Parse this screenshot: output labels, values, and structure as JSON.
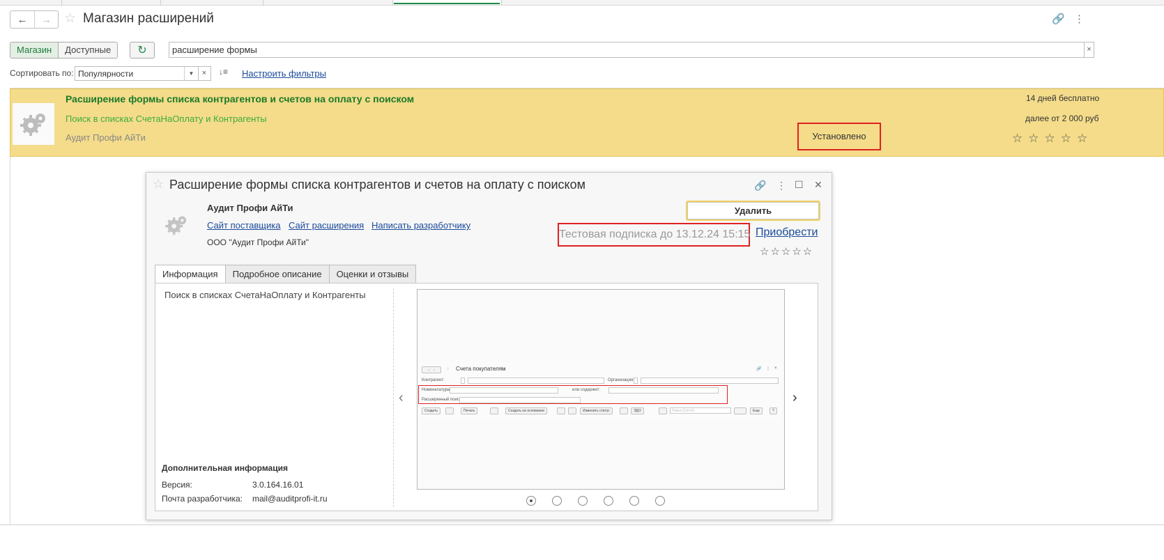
{
  "window": {
    "title": "Магазин расширений",
    "nav_back_icon": "←",
    "nav_forward_icon": "→",
    "favorite_icon": "☆",
    "link_icon": "🔗",
    "more_icon": "⋮"
  },
  "toolbar": {
    "tab_store": "Магазин",
    "tab_available": "Доступные",
    "refresh_icon": "↻",
    "search_value": "расширение формы",
    "search_clear": "×",
    "sort_label": "Сортировать по:",
    "sort_value": "Популярности",
    "sort_dropdown": "▼",
    "sort_clear": "×",
    "sort_order_icon": "↓≡",
    "filters_link": "Настроить фильтры"
  },
  "list": {
    "items": [
      {
        "title": "Расширение формы списка контрагентов и счетов на оплату с поиском",
        "description": "Поиск в списках СчетаНаОплату и Контрагенты",
        "vendor": "Аудит Профи АйТи",
        "status": "Установлено",
        "trial": "14 дней бесплатно",
        "price": "далее от 2 000 руб",
        "stars": "☆☆☆☆☆"
      }
    ]
  },
  "dialog": {
    "title": "Расширение формы списка контрагентов и счетов на оплату с поиском",
    "favorite_icon": "☆",
    "link_icon": "🔗",
    "more_icon": "⋮",
    "maximize_icon": "☐",
    "close_icon": "✕",
    "vendor_name": "Аудит Профи АйТи",
    "links": {
      "vendor_site": "Сайт поставщика",
      "extension_site": "Сайт расширения",
      "write_developer": "Написать разработчику"
    },
    "vendor_org": "ООО \"Аудит Профи АйТи\"",
    "delete_button": "Удалить",
    "trial_text": "Тестовая подписка до 13.12.24 15:15",
    "buy_link": "Приобрести",
    "stars": "☆☆☆☆☆",
    "tabs": [
      "Информация",
      "Подробное описание",
      "Оценки и отзывы"
    ],
    "active_tab": 0,
    "info": {
      "description": "Поиск в списках СчетаНаОплату и Контрагенты",
      "extra_heading": "Дополнительная информация",
      "version_label": "Версия:",
      "version_value": "3.0.164.16.01",
      "email_label": "Почта разработчика:",
      "email_value": "mail@auditprofi-it.ru"
    },
    "carousel": {
      "prev_icon": "‹",
      "next_icon": "›",
      "active_index": 0,
      "count": 6
    },
    "screenshot": {
      "title": "Счета покупателям",
      "back": "←",
      "forward": "→",
      "star": "☆",
      "link": "🔗",
      "more": "⋮",
      "close": "×",
      "field_counterparty": "Контрагент:",
      "field_organization": "Организация:",
      "field_nomenclature": "Номенклатура",
      "field_contains": "или содержит:",
      "field_extended": "Расширенный поиск:",
      "btn_create": "Создать",
      "btn_print": "Печать",
      "btn_create_based": "Создать на основании",
      "btn_change_status": "Изменить статус",
      "btn_edo": "ЭДО",
      "search_placeholder": "Поиск (Ctrl+F)",
      "btn_more": "Еще",
      "btn_help": "?"
    }
  }
}
